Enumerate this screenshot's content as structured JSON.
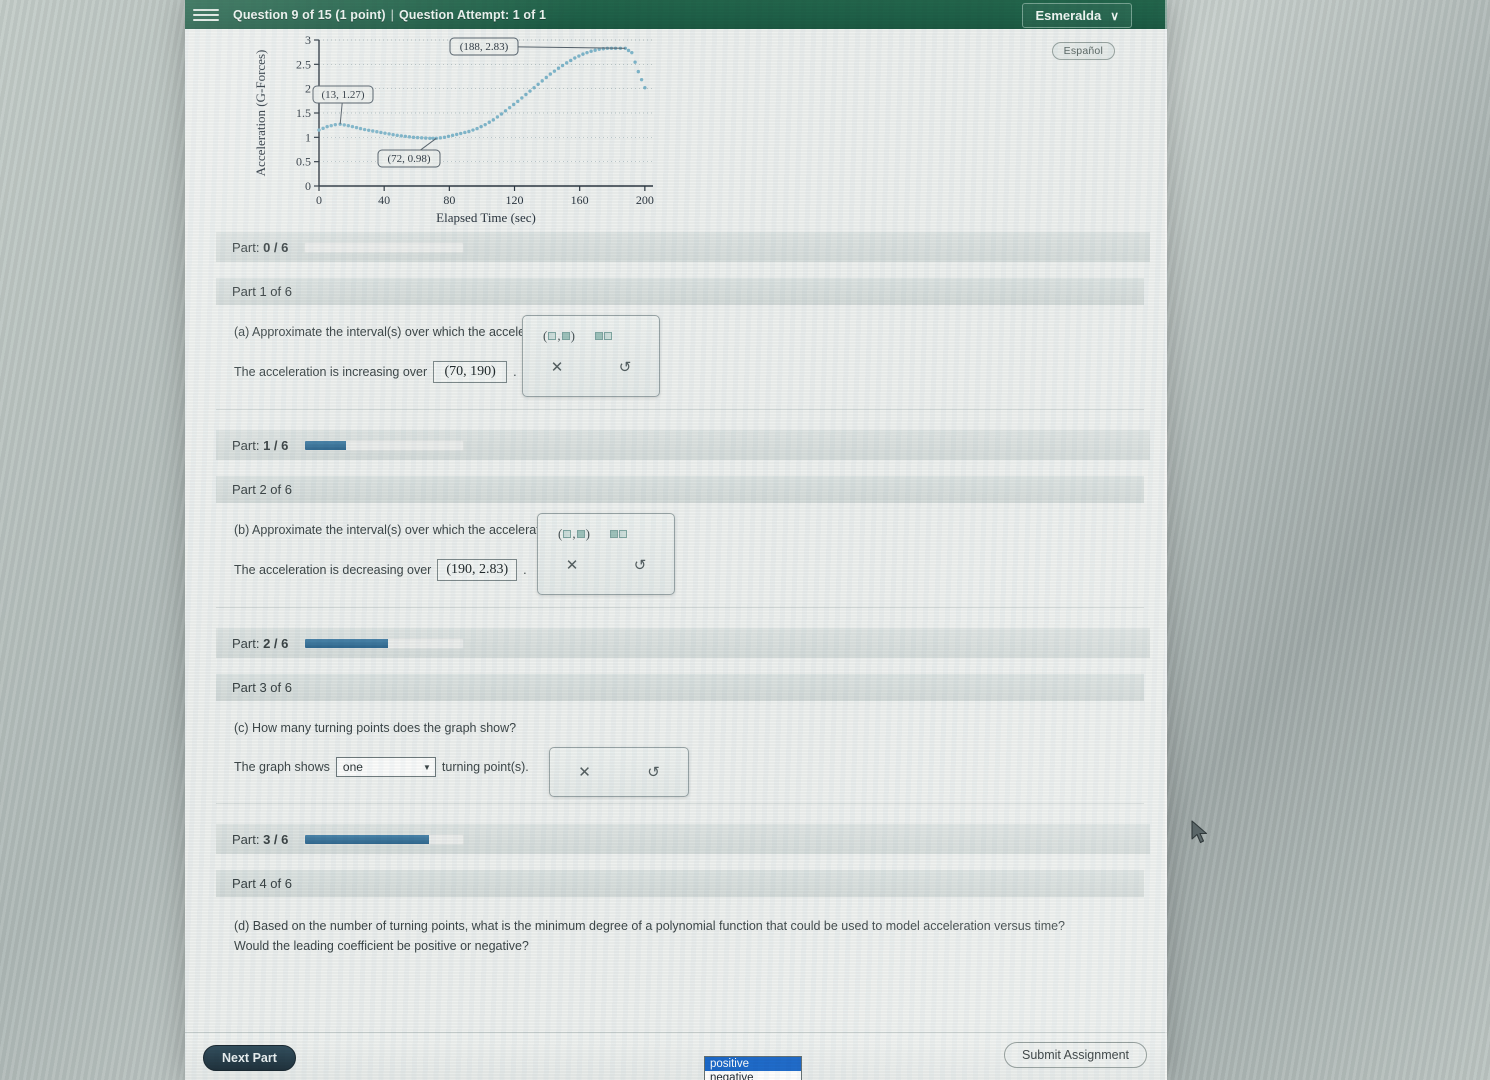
{
  "header": {
    "menu_icon": "hamburger-icon",
    "question_label": "Question 9 of 15 (1 point)",
    "separator": "|",
    "attempt_label": "Question Attempt: 1 of 1",
    "user_name": "Esmeralda",
    "user_chevron": "∨",
    "language_toggle": "Español",
    "bar_color": "#1e6048"
  },
  "chart_data": {
    "type": "scatter",
    "title": "",
    "xlabel": "Elapsed Time (sec)",
    "ylabel": "Acceleration (G-Forces)",
    "xlim": [
      0,
      205
    ],
    "ylim": [
      0,
      3
    ],
    "xticks": [
      0,
      40,
      80,
      120,
      160,
      200
    ],
    "yticks": [
      0,
      0.5,
      1,
      1.5,
      2,
      2.5,
      3
    ],
    "xtick_labels": [
      "0",
      "40",
      "80",
      "120",
      "160",
      "200"
    ],
    "ytick_labels": [
      "0",
      "0.5",
      "1",
      "1.5",
      "2",
      "2.5",
      "3"
    ],
    "grid": true,
    "marker_color": "#7fb7cc",
    "legend": "none",
    "annotations": [
      {
        "label": "(13, 1.27)",
        "x": 13,
        "y": 1.27
      },
      {
        "label": "(72, 0.98)",
        "x": 72,
        "y": 0.98
      },
      {
        "label": "(188, 2.83)",
        "x": 188,
        "y": 2.83
      }
    ],
    "x": [
      0,
      5,
      10,
      13,
      18,
      23,
      28,
      33,
      38,
      43,
      48,
      53,
      58,
      63,
      68,
      72,
      77,
      82,
      87,
      92,
      97,
      102,
      107,
      112,
      117,
      122,
      127,
      132,
      137,
      142,
      147,
      152,
      157,
      162,
      167,
      172,
      177,
      182,
      188,
      192,
      196,
      200
    ],
    "y": [
      1.15,
      1.22,
      1.26,
      1.27,
      1.24,
      1.2,
      1.16,
      1.13,
      1.1,
      1.07,
      1.04,
      1.02,
      1.0,
      0.99,
      0.98,
      0.98,
      1.0,
      1.04,
      1.08,
      1.12,
      1.18,
      1.26,
      1.36,
      1.48,
      1.61,
      1.74,
      1.88,
      2.02,
      2.16,
      2.3,
      2.42,
      2.53,
      2.63,
      2.71,
      2.77,
      2.81,
      2.83,
      2.83,
      2.83,
      2.74,
      2.35,
      2.02
    ]
  },
  "parts": [
    {
      "score_label_prefix": "Part:",
      "score_value": "0 / 6",
      "progress_pct": 0,
      "head": "Part 1 of 6",
      "question": "(a) Approximate the interval(s) over which the acceleration is increasing.",
      "answer_prefix": "The acceleration is increasing over",
      "answer_value": "(70, 190)",
      "answer_suffix": ".",
      "palette": {
        "glyph_interval": "(□,□)",
        "glyph_union": "□∪□",
        "clear_icon": "✕",
        "undo_icon": "↺"
      }
    },
    {
      "score_label_prefix": "Part:",
      "score_value": "1 / 6",
      "progress_pct": 26,
      "head": "Part 2 of 6",
      "question": "(b) Approximate the interval(s) over which the acceleration is decreasing.",
      "answer_prefix": "The acceleration is decreasing over",
      "answer_value": "(190, 2.83)",
      "answer_suffix": ".",
      "palette": {
        "glyph_interval": "(□,□)",
        "glyph_union": "□∪□",
        "clear_icon": "✕",
        "undo_icon": "↺"
      }
    },
    {
      "score_label_prefix": "Part:",
      "score_value": "2 / 6",
      "progress_pct": 52,
      "head": "Part 3 of 6",
      "question": "(c) How many turning points does the graph show?",
      "answer_prefix": "The graph shows",
      "select_value": "one",
      "select_caret": "▼",
      "answer_suffix": "turning point(s).",
      "palette": {
        "clear_icon": "✕",
        "undo_icon": "↺"
      }
    },
    {
      "score_label_prefix": "Part:",
      "score_value": "3 / 6",
      "progress_pct": 78,
      "head": "Part 4 of 6",
      "question_line1": "(d) Based on the number of turning points, what is the minimum degree of a polynomial function that could be used to model acceleration versus time?",
      "question_line2": "Would the leading coefficient be positive or negative?"
    }
  ],
  "open_dropdown": {
    "options": [
      "positive",
      "negative"
    ],
    "selected": "positive",
    "highlight_color": "#1464c8"
  },
  "footer": {
    "next_part_label": "Next Part",
    "submit_label": "Submit Assignment"
  },
  "cursor": {
    "icon": "mouse-pointer"
  }
}
